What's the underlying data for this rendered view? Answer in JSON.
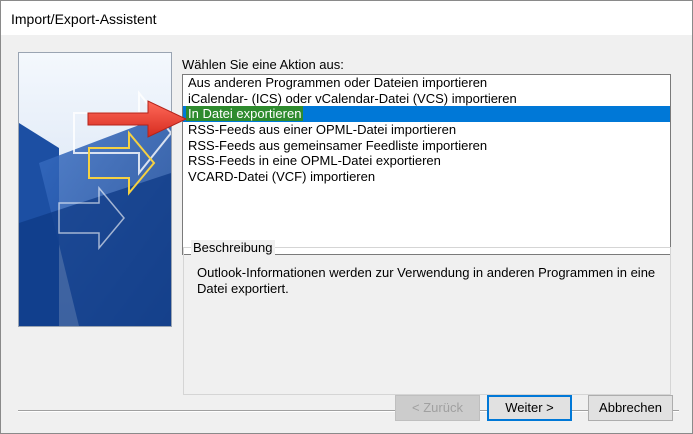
{
  "window": {
    "title": "Import/Export-Assistent"
  },
  "prompt": "Wählen Sie eine Aktion aus:",
  "actions": [
    {
      "label": "Aus anderen Programmen oder Dateien importieren",
      "selected": false
    },
    {
      "label": "iCalendar- (ICS) oder vCalendar-Datei (VCS) importieren",
      "selected": false
    },
    {
      "label": "In Datei exportieren",
      "selected": true
    },
    {
      "label": "RSS-Feeds aus einer OPML-Datei importieren",
      "selected": false
    },
    {
      "label": "RSS-Feeds aus gemeinsamer Feedliste importieren",
      "selected": false
    },
    {
      "label": "RSS-Feeds in eine OPML-Datei exportieren",
      "selected": false
    },
    {
      "label": "VCARD-Datei (VCF) importieren",
      "selected": false
    }
  ],
  "description": {
    "heading": "Beschreibung",
    "text": "Outlook-Informationen werden zur Verwendung in anderen Programmen in eine Datei exportiert."
  },
  "buttons": {
    "back": "< Zurück",
    "next": "Weiter >",
    "cancel": "Abbrechen"
  },
  "colors": {
    "selection": "#0078d7",
    "highlight": "#2e8b2e",
    "annotation_arrow": "#e53935"
  }
}
